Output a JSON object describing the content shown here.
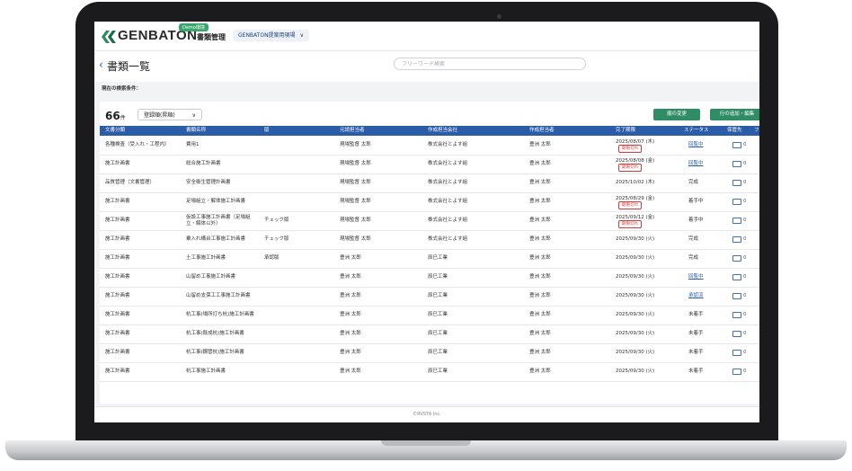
{
  "header": {
    "logo_text": "GENBATON",
    "demo_badge": "Demo環境",
    "app_title": "書類管理",
    "site_selector": "GENBATON提案用現場",
    "site_chevron": "∨"
  },
  "page": {
    "back_icon": "‹",
    "title": "書類一覧",
    "search_placeholder": "フリーワード検索",
    "criteria_label": "現在の検索条件："
  },
  "toolbar": {
    "count": "66",
    "count_unit": "件",
    "sort_value": "登録順(昇順)",
    "sort_chevron": "∨",
    "order_button": "順の変更",
    "columns_button": "行の追加・編集"
  },
  "table": {
    "headers": [
      "文書分類",
      "書類名称",
      "版",
      "元請担当者",
      "作成担当会社",
      "作成担当者",
      "完了期限",
      "ステータス",
      "保管先",
      "フ"
    ],
    "rows": [
      {
        "category": "各種検査（受入れ・工程内）",
        "name": "費用1",
        "version": "",
        "gc": "現場監督 太郎",
        "company": "株式会社とよす組",
        "author": "豊洲 太郎",
        "due": "2025/08/07 (木)",
        "overdue": "期限切れ",
        "status": "回覧中",
        "status_link": true,
        "files": "0"
      },
      {
        "category": "施工計画書",
        "name": "総合施工計画書",
        "version": "",
        "gc": "現場監督 太郎",
        "company": "株式会社とよす組",
        "author": "豊洲 太郎",
        "due": "2025/08/08 (金)",
        "overdue": "期限切れ",
        "status": "回覧中",
        "status_link": true,
        "files": "0"
      },
      {
        "category": "品質管理（文書管理）",
        "name": "安全衛生管理計画書",
        "version": "",
        "gc": "現場監督 太郎",
        "company": "株式会社とよす組",
        "author": "豊洲 太郎",
        "due": "2025/10/02 (木)",
        "overdue": "",
        "status": "完成",
        "status_link": false,
        "files": "0"
      },
      {
        "category": "施工計画書",
        "name": "足場組立・解体施工計画書",
        "version": "",
        "gc": "現場監督 太郎",
        "company": "株式会社とよす組",
        "author": "豊洲 太郎",
        "due": "2025/08/29 (金)",
        "overdue": "期限切れ",
        "status": "着手中",
        "status_link": false,
        "files": "0"
      },
      {
        "category": "施工計画書",
        "name": "仮設工事施工計画書（足場組立・解体以外）",
        "version": "チェック版",
        "gc": "現場監督 太郎",
        "company": "株式会社とよす組",
        "author": "豊洲 太郎",
        "due": "2025/09/12 (金)",
        "overdue": "期限切れ",
        "status": "着手中",
        "status_link": false,
        "files": "0"
      },
      {
        "category": "施工計画書",
        "name": "乗入れ構台工事施工計画書",
        "version": "チェック版",
        "gc": "現場監督 太郎",
        "company": "株式会社とよす組",
        "author": "豊洲 太郎",
        "due": "2025/09/30 (火)",
        "overdue": "",
        "status": "完成",
        "status_link": false,
        "files": "0"
      },
      {
        "category": "施工計画書",
        "name": "土工事施工計画書",
        "version": "承認版",
        "gc": "豊洲 太郎",
        "company": "辰巳工業",
        "author": "豊洲 太郎",
        "due": "2025/09/30 (火)",
        "overdue": "",
        "status": "完成",
        "status_link": false,
        "files": "0"
      },
      {
        "category": "施工計画書",
        "name": "山留め工事施工計画書",
        "version": "",
        "gc": "豊洲 太郎",
        "company": "辰巳工業",
        "author": "豊洲 太郎",
        "due": "2025/09/30 (火)",
        "overdue": "",
        "status": "回覧中",
        "status_link": true,
        "files": "0"
      },
      {
        "category": "施工計画書",
        "name": "山留め支保工工事施工計画書",
        "version": "",
        "gc": "豊洲 太郎",
        "company": "辰巳工業",
        "author": "豊洲 太郎",
        "due": "2025/09/30 (火)",
        "overdue": "",
        "status": "承認済",
        "status_link": true,
        "files": "0"
      },
      {
        "category": "施工計画書",
        "name": "杭工事(場所打ち杭)施工計画書",
        "version": "",
        "gc": "豊洲 太郎",
        "company": "辰巳工業",
        "author": "豊洲 太郎",
        "due": "2025/09/30 (火)",
        "overdue": "",
        "status": "未着手",
        "status_link": false,
        "files": "0"
      },
      {
        "category": "施工計画書",
        "name": "杭工事(既成杭)施工計画書",
        "version": "",
        "gc": "豊洲 太郎",
        "company": "辰巳工業",
        "author": "豊洲 太郎",
        "due": "2025/09/30 (火)",
        "overdue": "",
        "status": "未着手",
        "status_link": false,
        "files": "0"
      },
      {
        "category": "施工計画書",
        "name": "杭工事(鋼管杭)施工計画書",
        "version": "",
        "gc": "豊洲 太郎",
        "company": "辰巳工業",
        "author": "豊洲 太郎",
        "due": "2025/09/30 (火)",
        "overdue": "",
        "status": "未着手",
        "status_link": false,
        "files": "0"
      },
      {
        "category": "施工計画書",
        "name": "杭工事施工計画書",
        "version": "",
        "gc": "豊洲 太郎",
        "company": "辰巳工業",
        "author": "豊洲 太郎",
        "due": "2025/09/30 (火)",
        "overdue": "",
        "status": "未着手",
        "status_link": false,
        "files": "0"
      }
    ]
  },
  "footer": {
    "copyright": "©RVSTA Inc."
  },
  "colors": {
    "brand_green": "#2f8c64",
    "header_blue": "#2b5ca8",
    "overdue_red": "#d03a3a"
  }
}
